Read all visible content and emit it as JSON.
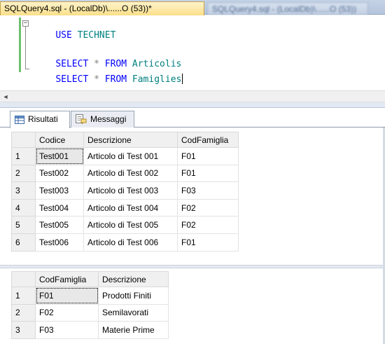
{
  "document_tabs": {
    "active_title": "SQLQuery4.sql - (LocalDb)\\......O (53))*",
    "inactive_title": "SQLQuery4.sql - (LocalDb)\\......O (53))"
  },
  "editor": {
    "lines": [
      {
        "kw1": "USE",
        "rest": "TECHNET"
      },
      {
        "kw1": "SELECT",
        "star": "*",
        "kw2": "FROM",
        "table": "Articolis"
      },
      {
        "kw1": "SELECT",
        "star": "*",
        "kw2": "FROM",
        "table": "Famiglies"
      }
    ],
    "collapse_glyph": "−"
  },
  "colors": {
    "keyword": "#0000ff",
    "identifier": "#008080",
    "operator": "#808080",
    "active_tab": "#fbe08a"
  },
  "result_tabs": [
    {
      "label": "Risultati",
      "icon": "grid-icon",
      "active": true
    },
    {
      "label": "Messaggi",
      "icon": "messages-icon",
      "active": false
    }
  ],
  "grid1": {
    "columns": [
      "Codice",
      "Descrizione",
      "CodFamiglia"
    ],
    "rows": [
      {
        "n": "1",
        "cells": [
          "Test001",
          "Articolo di Test 001",
          "F01"
        ]
      },
      {
        "n": "2",
        "cells": [
          "Test002",
          "Articolo di Test 002",
          "F01"
        ]
      },
      {
        "n": "3",
        "cells": [
          "Test003",
          "Articolo di Test 003",
          "F03"
        ]
      },
      {
        "n": "4",
        "cells": [
          "Test004",
          "Articolo di Test 004",
          "F02"
        ]
      },
      {
        "n": "5",
        "cells": [
          "Test005",
          "Articolo di Test 005",
          "F02"
        ]
      },
      {
        "n": "6",
        "cells": [
          "Test006",
          "Articolo di Test 006",
          "F01"
        ]
      }
    ]
  },
  "grid2": {
    "columns": [
      "CodFamiglia",
      "Descrizione"
    ],
    "rows": [
      {
        "n": "1",
        "cells": [
          "F01",
          "Prodotti Finiti"
        ]
      },
      {
        "n": "2",
        "cells": [
          "F02",
          "Semilavorati"
        ]
      },
      {
        "n": "3",
        "cells": [
          "F03",
          "Materie Prime"
        ]
      }
    ]
  },
  "scrollbar": {
    "left_arrow": "◄"
  }
}
